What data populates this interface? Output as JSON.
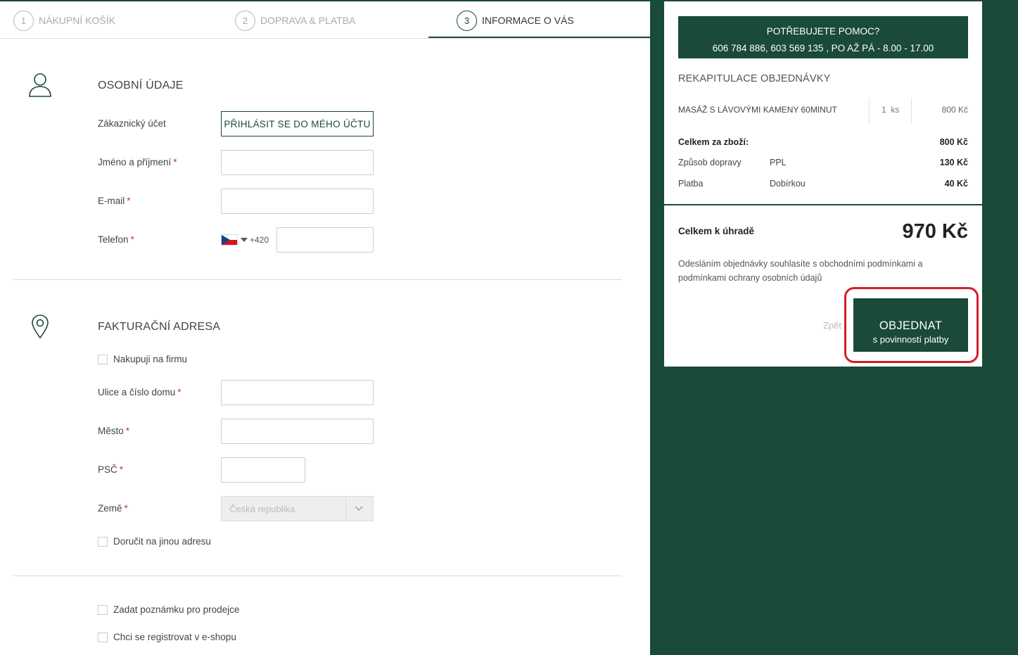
{
  "steps": [
    {
      "num": "1",
      "label": "NÁKUPNÍ KOŠÍK"
    },
    {
      "num": "2",
      "label": "DOPRAVA & PLATBA"
    },
    {
      "num": "3",
      "label": "INFORMACE O VÁS"
    }
  ],
  "personal": {
    "title": "OSOBNÍ ÚDAJE",
    "account_label": "Zákaznický účet",
    "login_button": "PŘIHLÁSIT SE DO MÉHO ÚČTU",
    "name_label": "Jméno a příjmení",
    "email_label": "E-mail",
    "phone_label": "Telefon",
    "phone_prefix": "+420",
    "required_mark": "*"
  },
  "billing": {
    "title": "FAKTURAČNÍ ADRESA",
    "company_checkbox": "Nakupuji na firmu",
    "street_label": "Ulice a číslo domu",
    "city_label": "Město",
    "zip_label": "PSČ",
    "country_label": "Země",
    "country_value": "Česká republika",
    "other_address_checkbox": "Doručit na jinou adresu"
  },
  "extras": {
    "note_checkbox": "Zadat poznámku pro prodejce",
    "register_checkbox": "Chci se registrovat v e-shopu"
  },
  "help": {
    "title": "POTŘEBUJETE POMOC?",
    "contact": "606 784 886, 603 569 135 , PO AŽ PÁ - 8.00 - 17.00"
  },
  "recap": {
    "title": "REKAPITULACE OBJEDNÁVKY",
    "item_name": "MASÁŽ S LÁVOVÝMI KAMENY 60MINUT",
    "item_qty": "1",
    "item_unit": "ks",
    "item_price": "800 Kč",
    "goods_total_label": "Celkem za zboží:",
    "goods_total_value": "800 Kč",
    "shipping_label": "Způsob dopravy",
    "shipping_method": "PPL",
    "shipping_price": "130 Kč",
    "payment_label": "Platba",
    "payment_method": "Dobírkou",
    "payment_price": "40 Kč",
    "total_label": "Celkem k úhradě",
    "total_value": "970 Kč",
    "terms": "Odesláním objednávky souhlasíte s obchodními podmínkami a podmínkami ochrany osobních údajů",
    "back_label": "Zpět",
    "order_button_main": "OBJEDNAT",
    "order_button_sub": "s povinností platby"
  },
  "colors": {
    "brand_green": "#1a4a38",
    "highlight_red": "#d0202a",
    "required_red": "#c0392b"
  }
}
